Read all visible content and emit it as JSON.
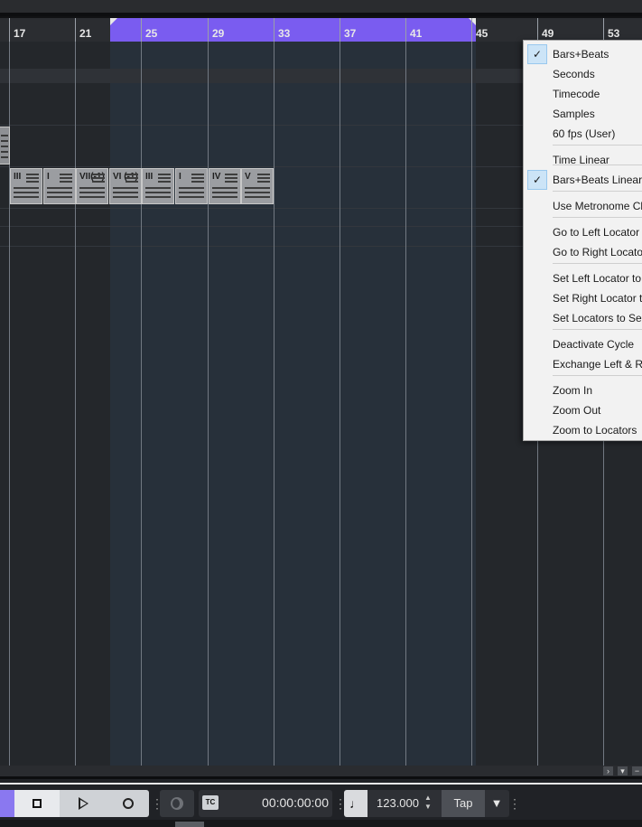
{
  "ruler": {
    "bars": [
      "17",
      "21",
      "25",
      "29",
      "33",
      "37",
      "41",
      "45",
      "49",
      "53"
    ]
  },
  "parts": {
    "chords": [
      "III",
      "I",
      "VII(-1)",
      "VI (-1)",
      "III",
      "I",
      "IV",
      "V"
    ]
  },
  "menu": {
    "items": [
      {
        "label": "Bars+Beats",
        "checked": true
      },
      {
        "label": "Seconds",
        "checked": false
      },
      {
        "label": "Timecode",
        "checked": false
      },
      {
        "label": "Samples",
        "checked": false
      },
      {
        "label": "60 fps (User)",
        "checked": false
      },
      {
        "label": "Time Linear",
        "checked": false
      },
      {
        "label": "Bars+Beats Linear",
        "checked": true
      },
      {
        "label": "Use Metronome Cl",
        "checked": false
      },
      {
        "label": "Go to Left Locator",
        "checked": false
      },
      {
        "label": "Go to Right Locato",
        "checked": false
      },
      {
        "label": "Set Left Locator to",
        "checked": false
      },
      {
        "label": "Set Right Locator t",
        "checked": false
      },
      {
        "label": "Set Locators to Sel",
        "checked": false
      },
      {
        "label": "Deactivate Cycle",
        "checked": false
      },
      {
        "label": "Exchange Left & Ri",
        "checked": false
      },
      {
        "label": "Zoom In",
        "checked": false
      },
      {
        "label": "Zoom Out",
        "checked": false
      },
      {
        "label": "Zoom to Locators",
        "checked": false
      }
    ]
  },
  "transport": {
    "timecode": "00:00:00:00",
    "tc_icon": "TC",
    "tempo": "123.000",
    "tap_label": "Tap",
    "tempo_icon": "♩"
  },
  "scroll": {
    "right_glyph": "›",
    "down_glyph": "▾",
    "minus_glyph": "−"
  },
  "colors": {
    "cycle": "#7a5cf0",
    "menu_check_bg": "#cce4f7"
  }
}
